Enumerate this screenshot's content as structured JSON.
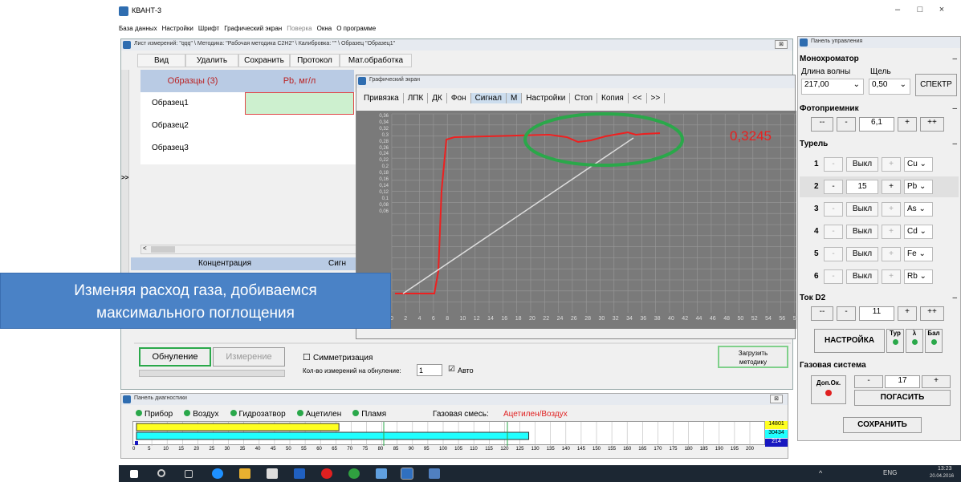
{
  "app": {
    "title": "КВАНТ-3",
    "min": "–",
    "max": "□",
    "close": "×"
  },
  "menu": [
    "База данных",
    "Настройки",
    "Шрифт",
    "Графический экран",
    "Поверка",
    "Окна",
    "О программе"
  ],
  "measwin": {
    "title": "Лист измерений: \"qqq\" \\ Методика: \"Рабочая методика С2Н2\" \\ Калибровка: \"\" \\ Образец \"Образец1\"",
    "close": "⊠",
    "toolbar": [
      "Вид",
      "Удалить",
      "Сохранить",
      "Протокол",
      "Мат.обработка"
    ],
    "col_samples": "Образцы (3)",
    "col_pb": "Pb, мг/л",
    "rows": [
      "Образец1",
      "Образец2",
      "Образец3"
    ],
    "expander": ">>",
    "scroll_left": "<",
    "foot_conc": "Концентрация",
    "foot_signal": "Сигн"
  },
  "graph": {
    "title": "Графический экран",
    "buttons": [
      "Привязка",
      "ЛПК",
      "ДК",
      "Фон",
      "Сигнал",
      "М",
      "Настройки",
      "Стоп",
      "Копия",
      "<<",
      ">>"
    ],
    "value": "0,3245",
    "yticks": [
      "0,36",
      "0,34",
      "0,32",
      "0,3",
      "0,28",
      "0,26",
      "0,24",
      "0,22",
      "0,2",
      "0,18",
      "0,16",
      "0,14",
      "0,12",
      "0,1",
      "0,08",
      "0,06"
    ],
    "xticks": [
      "0",
      "2",
      "4",
      "6",
      "8",
      "10",
      "12",
      "14",
      "16",
      "18",
      "20",
      "22",
      "24",
      "26",
      "28",
      "30",
      "32",
      "34",
      "36",
      "38",
      "40",
      "42",
      "44",
      "46",
      "48",
      "50",
      "52",
      "54",
      "56",
      "58"
    ]
  },
  "callout": {
    "line1": "Изменяя расход газа, добиваемся",
    "line2": "максимального поглощения"
  },
  "bottom": {
    "zero": "Обнуление",
    "measure": "Измерение",
    "symmetry": "Симметризация",
    "count_label": "Кол-во измерений на обнуление:",
    "count": "1",
    "auto": "Авто",
    "load1": "Загрузить",
    "load2": "методику",
    "check": "☑",
    "uncheck": "☐"
  },
  "control": {
    "title": "Панель управления",
    "mono": "Монохроматор",
    "wave_label": "Длина волны",
    "slit_label": "Щель",
    "wave": "217,00",
    "slit": "0,50",
    "spectrum": "СПЕКТР",
    "photo": "Фотоприемник",
    "photo_val": "6,1",
    "mm": "--",
    "m": "-",
    "p": "+",
    "pp": "++",
    "minimize": "–",
    "turret": "Турель",
    "turret_rows": [
      {
        "n": "1",
        "v": "Выкл",
        "el": "Cu"
      },
      {
        "n": "2",
        "v": "15",
        "el": "Pb"
      },
      {
        "n": "3",
        "v": "Выкл",
        "el": "As"
      },
      {
        "n": "4",
        "v": "Выкл",
        "el": "Cd"
      },
      {
        "n": "5",
        "v": "Выкл",
        "el": "Fe"
      },
      {
        "n": "6",
        "v": "Выкл",
        "el": "Rb"
      }
    ],
    "d2": "Ток D2",
    "d2_val": "11",
    "setup": "НАСТРОЙКА",
    "tur": "Тур",
    "lambda": "λ",
    "bal": "Бал",
    "gas": "Газовая система",
    "dop": "Доп.Ок.",
    "gas_val": "17",
    "off": "ПОГАСИТЬ",
    "save": "СОХРАНИТЬ"
  },
  "diag": {
    "title": "Панель диагностики",
    "items": [
      "Прибор",
      "Воздух",
      "Гидрозатвор",
      "Ацетилен",
      "Пламя"
    ],
    "mix_label": "Газовая смесь:",
    "mix": "Ацетилен/Воздух",
    "v1": "14801",
    "v2": "30434",
    "v3": "214",
    "bar_yellow": 0.32,
    "bar_cyan": 0.62,
    "axis": [
      "0",
      "5",
      "10",
      "15",
      "20",
      "25",
      "30",
      "35",
      "40",
      "45",
      "50",
      "55",
      "60",
      "65",
      "70",
      "75",
      "80",
      "85",
      "90",
      "95",
      "100",
      "105",
      "110",
      "115",
      "120",
      "125",
      "130",
      "135",
      "140",
      "145",
      "150",
      "155",
      "160",
      "165",
      "170",
      "175",
      "180",
      "185",
      "190",
      "195",
      "200"
    ]
  },
  "taskbar": {
    "lang": "ENG",
    "time": "13:23",
    "date": "20.04.2016",
    "tray": "^"
  },
  "colors": {
    "accent": "#2f6db0",
    "signal": "#e82020",
    "highlight": "#2aa84a"
  }
}
